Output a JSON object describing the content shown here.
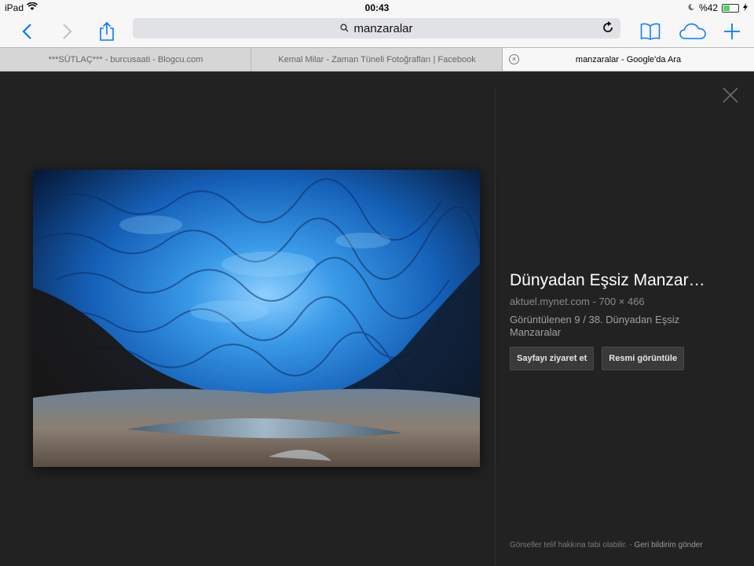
{
  "status": {
    "device": "iPad",
    "time": "00:43",
    "battery": "%42",
    "battery_level": 0.42
  },
  "navbar": {
    "url_text": "manzaralar",
    "icons": [
      "back-icon",
      "forward-icon",
      "share-icon",
      "search-icon",
      "reload-icon",
      "bookmarks-icon",
      "icloud-tabs-icon",
      "new-tab-icon"
    ]
  },
  "tabs": [
    {
      "label": "***SÜTLAÇ*** - burcusaati - Blogcu.com"
    },
    {
      "label": "Kemal Milar - Zaman Tüneli Fotoğrafları | Facebook"
    },
    {
      "label": "manzaralar - Google'da Ara"
    }
  ],
  "viewer": {
    "title": "Dünyadan Eşsiz Manzar…",
    "source": "aktuel.mynet.com",
    "dimensions": "700 × 466",
    "description": "Görüntülenen 9 / 38. Dünyadan Eşsiz Manzaralar",
    "visit_button": "Sayfayı ziyaret et",
    "view_button": "Resmi görüntüle",
    "footer_text": "Görseller telif hakkına tabi olabilir.",
    "footer_sep": "-",
    "footer_link": "Geri bildirim gönder"
  },
  "colors": {
    "accent": "#007aff",
    "viewer_bg": "#222222",
    "photo_blue": "#1e7fd6"
  }
}
